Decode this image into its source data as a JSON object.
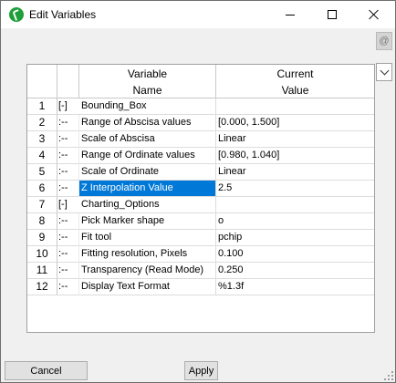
{
  "window": {
    "title": "Edit Variables"
  },
  "toolbar": {
    "at_label": "@"
  },
  "grid": {
    "headers": {
      "name_line1": "Variable",
      "name_line2": "Name",
      "value_line1": "Current",
      "value_line2": "Value"
    },
    "rows": [
      {
        "num": "1",
        "tree": "[-]",
        "name": "Bounding_Box",
        "value": "",
        "group": true
      },
      {
        "num": "2",
        "tree": ":--",
        "name": "Range of Abscisa values",
        "value": "[0.000, 1.500]"
      },
      {
        "num": "3",
        "tree": ":--",
        "name": "Scale of Abscisa",
        "value": "Linear"
      },
      {
        "num": "4",
        "tree": ":--",
        "name": "Range of Ordinate values",
        "value": "[0.980, 1.040]"
      },
      {
        "num": "5",
        "tree": ":--",
        "name": "Scale of Ordinate",
        "value": "Linear"
      },
      {
        "num": "6",
        "tree": ":--",
        "name": "Z Interpolation Value",
        "value": "2.5",
        "selected": true
      },
      {
        "num": "7",
        "tree": "[-]",
        "name": "Charting_Options",
        "value": "",
        "group": true
      },
      {
        "num": "8",
        "tree": ":--",
        "name": "Pick Marker shape",
        "value": "o"
      },
      {
        "num": "9",
        "tree": ":--",
        "name": "Fit tool",
        "value": "pchip"
      },
      {
        "num": "10",
        "tree": ":--",
        "name": "Fitting resolution, Pixels",
        "value": "0.100"
      },
      {
        "num": "11",
        "tree": ":--",
        "name": "Transparency (Read Mode)",
        "value": "0.250"
      },
      {
        "num": "12",
        "tree": ":--",
        "name": "Display Text Format",
        "value": "%1.3f"
      }
    ]
  },
  "buttons": {
    "cancel": "Cancel",
    "apply": "Apply"
  }
}
